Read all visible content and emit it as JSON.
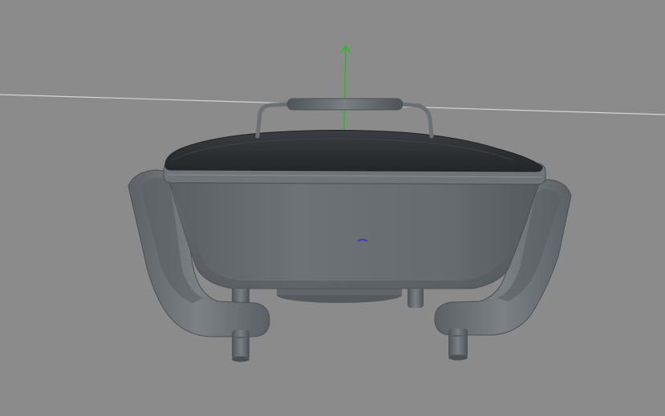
{
  "viewport": {
    "background_color": "#8b8b8b",
    "horizon_line_color": "#d6d6d6",
    "axis_y_color": "#17c517",
    "axis_origin_color": "#2b2bd6"
  },
  "model": {
    "name_icon": "electric-skillet-3d-model",
    "body_color": "#656a6f",
    "lid_color": "#2b2e31",
    "handle_color": "#777c81"
  }
}
